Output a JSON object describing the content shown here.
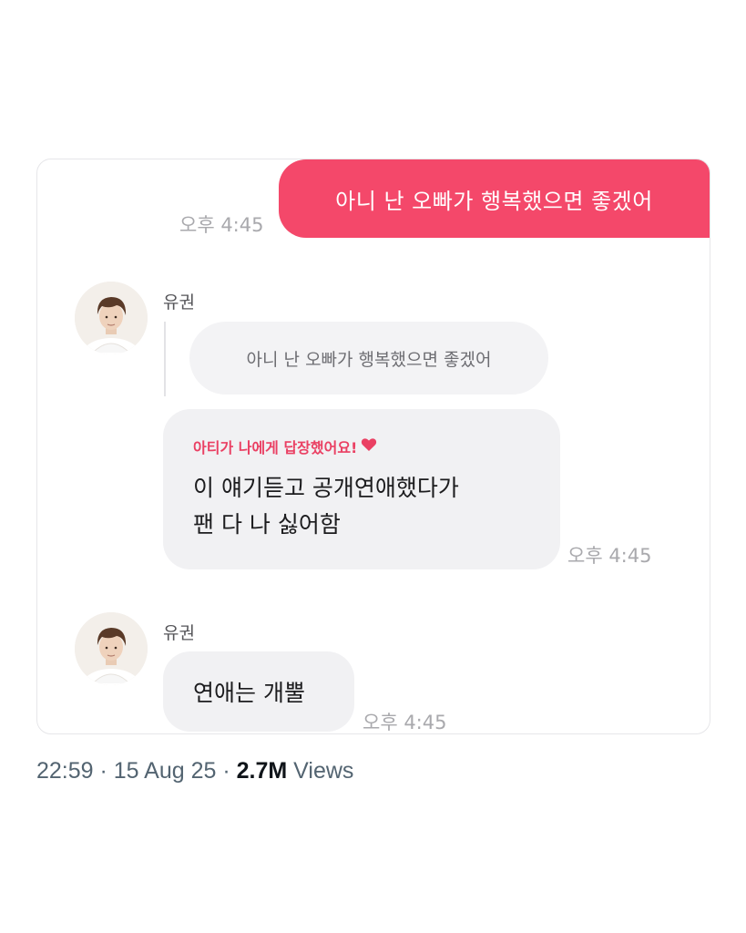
{
  "chat": {
    "sent_message": {
      "text": "아니 난 오빠가 행복했으면 좋겠어",
      "time": "오후 4:45"
    },
    "reply_group": {
      "sender": "유권",
      "quoted_text": "아니 난 오빠가 행복했으면 좋겠어",
      "reply_header": "아티가 나에게 답장했어요!",
      "reply_text": "이 얘기듣고 공개연애했다가\n팬 다 나 싫어함",
      "time": "오후 4:45"
    },
    "second_group": {
      "sender": "유권",
      "text": "연애는 개뿔",
      "time": "오후 4:45"
    }
  },
  "tweet_meta": {
    "time": "22:59",
    "sep1": " · ",
    "date": "15 Aug 25",
    "sep2": " · ",
    "views_count": "2.7M",
    "views_label": " Views"
  },
  "colors": {
    "sent_bubble": "#f4486a",
    "reply_header": "#ea4063",
    "received_bubble": "#f1f1f3"
  },
  "icons": {
    "reply_heart": "heart-icon",
    "avatar": "profile-photo"
  }
}
